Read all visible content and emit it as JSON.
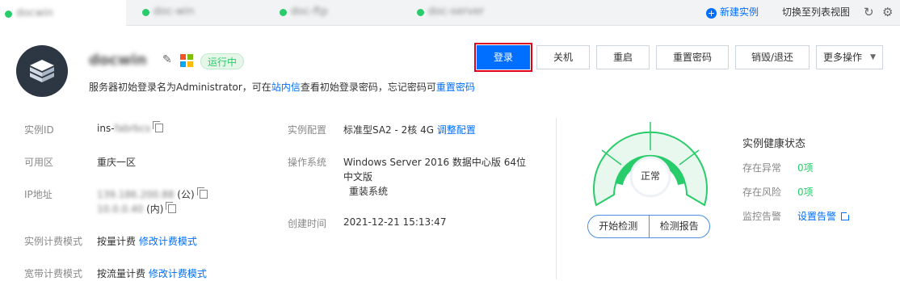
{
  "tabs": [
    {
      "name": "docwin",
      "active": true
    },
    {
      "name": "doc-win",
      "active": false
    },
    {
      "name": "doc-ftp",
      "active": false
    },
    {
      "name": "doc-server",
      "active": false
    }
  ],
  "tabbar": {
    "new_instance": "新建实例",
    "switch_view": "切换至列表视图",
    "refresh_icon": "refresh-icon",
    "settings_icon": "gear-icon"
  },
  "header": {
    "instance_name": "docwin",
    "status": "运行中",
    "tip_prefix": "服务器初始登录名为Administrator，可在",
    "tip_link1": "站内信",
    "tip_middle": "查看初始登录密码，忘记密码可",
    "tip_link2": "重置密码"
  },
  "actions": {
    "login": "登录",
    "shutdown": "关机",
    "restart": "重启",
    "reset_password": "重置密码",
    "destroy": "销毁/退还",
    "more": "更多操作"
  },
  "details": {
    "instance_id_label": "实例ID",
    "instance_id_prefix": "ins-",
    "instance_id_masked": "fabrbcs",
    "zone_label": "可用区",
    "zone_value": "重庆一区",
    "ip_label": "IP地址",
    "public_ip": "139.186.200.88",
    "public_suffix": "(公)",
    "private_ip": "10.0.0.40",
    "private_suffix": "(内)",
    "billing_label": "实例计费模式",
    "billing_value": "按量计费",
    "billing_link": "修改计费模式",
    "bandwidth_label": "宽带计费模式",
    "bandwidth_value": "按流量计费",
    "bandwidth_link": "修改计费模式",
    "config_label": "实例配置",
    "config_value": "标准型SA2 - 2核 4G",
    "config_link": "调整配置",
    "os_label": "操作系统",
    "os_value_line1": "Windows Server 2016 数据中心版 64位",
    "os_value_line2": "中文版",
    "os_link": "重装系统",
    "created_label": "创建时间",
    "created_value": "2021-12-21 15:13:47"
  },
  "health": {
    "gauge_text": "正常",
    "start_check": "开始检测",
    "report": "检测报告",
    "title": "实例健康状态",
    "abnormal_label": "存在异常",
    "abnormal_value": "0项",
    "risk_label": "存在风险",
    "risk_value": "0项",
    "alarm_label": "监控告警",
    "alarm_link": "设置告警"
  },
  "colors": {
    "primary": "#006eff",
    "success": "#29cc6a",
    "highlight_border": "#e0001c"
  }
}
